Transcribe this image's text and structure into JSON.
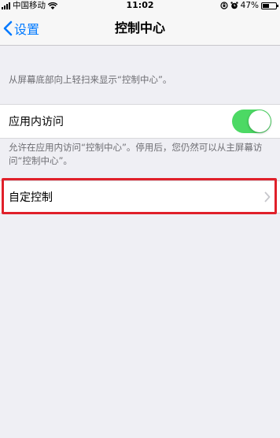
{
  "status_bar": {
    "carrier": "中国移动",
    "time": "11:02",
    "battery": "47%",
    "battery_level": 0.47
  },
  "nav": {
    "back_label": "设置",
    "title": "控制中心"
  },
  "hint_top": "从屏幕底部向上轻扫来显示“控制中心”。",
  "in_app_access": {
    "label": "应用内访问",
    "enabled": true,
    "footnote": "允许在应用内访问“控制中心”。停用后，您仍然可以从主屏幕访问“控制中心”。"
  },
  "customize": {
    "label": "自定控制"
  },
  "colors": {
    "accent": "#007aff",
    "toggle_on": "#4cd964",
    "highlight": "#e0202a",
    "background": "#efeff4"
  }
}
